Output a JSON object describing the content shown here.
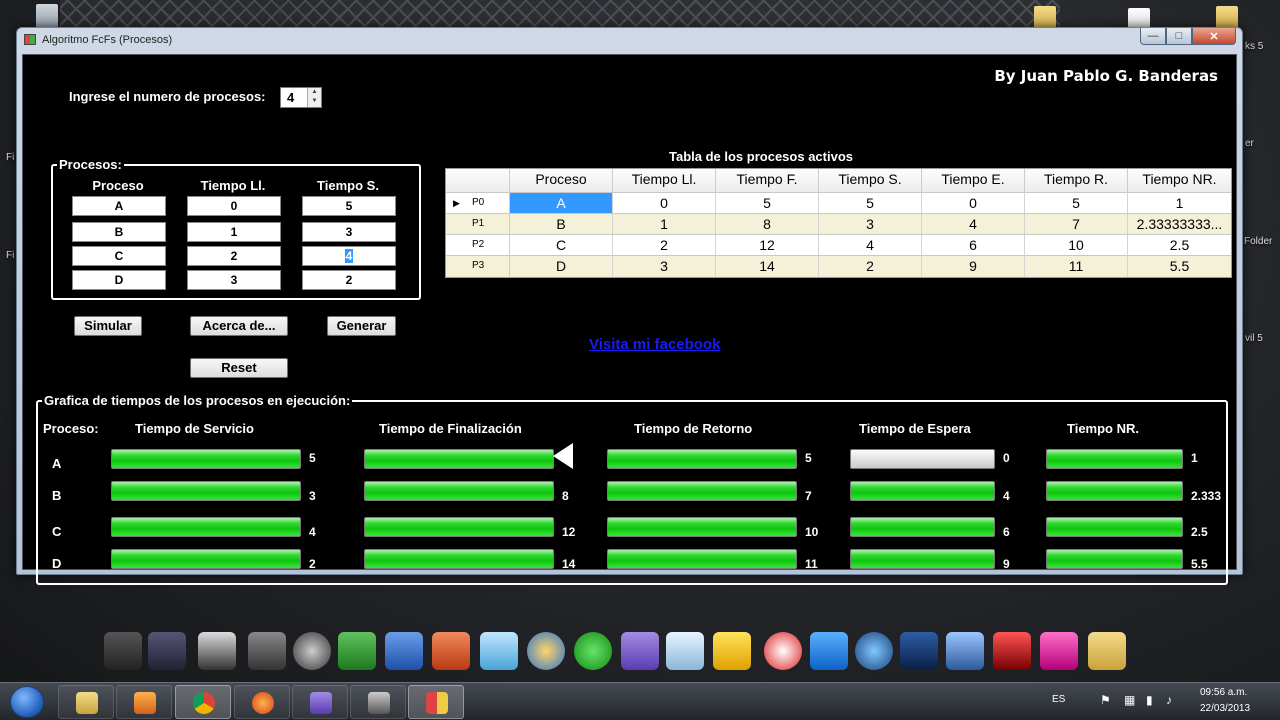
{
  "window": {
    "title": "Algoritmo FcFs (Procesos)",
    "author": "By Juan Pablo G. Banderas"
  },
  "input": {
    "label": "Ingrese el numero de procesos:",
    "count": "4"
  },
  "procesos_group": {
    "title": "Procesos:",
    "headers": [
      "Proceso",
      "Tiempo Ll.",
      "Tiempo S."
    ],
    "rows": [
      {
        "proceso": "A",
        "llegada": "0",
        "servicio": "5"
      },
      {
        "proceso": "B",
        "llegada": "1",
        "servicio": "3"
      },
      {
        "proceso": "C",
        "llegada": "2",
        "servicio": "4"
      },
      {
        "proceso": "D",
        "llegada": "3",
        "servicio": "2"
      }
    ]
  },
  "buttons": {
    "simular": "Simular",
    "acerca": "Acerca de...",
    "generar": "Generar",
    "reset": "Reset"
  },
  "link": "Visita mi facebook",
  "table": {
    "title": "Tabla de los procesos activos",
    "headers": [
      "Proceso",
      "Tiempo Ll.",
      "Tiempo F.",
      "Tiempo S.",
      "Tiempo E.",
      "Tiempo R.",
      "Tiempo NR."
    ],
    "rows": [
      {
        "id": "P0",
        "cells": [
          "A",
          "0",
          "5",
          "5",
          "0",
          "5",
          "1"
        ]
      },
      {
        "id": "P1",
        "cells": [
          "B",
          "1",
          "8",
          "3",
          "4",
          "7",
          "2.33333333..."
        ]
      },
      {
        "id": "P2",
        "cells": [
          "C",
          "2",
          "12",
          "4",
          "6",
          "10",
          "2.5"
        ]
      },
      {
        "id": "P3",
        "cells": [
          "D",
          "3",
          "14",
          "2",
          "9",
          "11",
          "5.5"
        ]
      }
    ]
  },
  "chart_group": {
    "title": "Grafica de tiempos de los procesos en ejecución:",
    "row_header": "Proceso:",
    "columns": [
      "Tiempo de Servicio",
      "Tiempo de Finalización",
      "Tiempo de Retorno",
      "Tiempo de Espera",
      "Tiempo NR."
    ],
    "processes": [
      "A",
      "B",
      "C",
      "D"
    ],
    "values": [
      [
        "5",
        "3",
        "4",
        "2"
      ],
      [
        "",
        "8",
        "12",
        "14"
      ],
      [
        "5",
        "7",
        "10",
        "11"
      ],
      [
        "0",
        "4",
        "6",
        "9"
      ],
      [
        "1",
        "2.333",
        "2.5",
        "5.5"
      ]
    ],
    "fills": [
      [
        1,
        1,
        1,
        1
      ],
      [
        1,
        1,
        1,
        1
      ],
      [
        1,
        1,
        1,
        1
      ],
      [
        0,
        1,
        1,
        1
      ],
      [
        1,
        1,
        1,
        1
      ]
    ]
  },
  "taskbar": {
    "lang": "ES",
    "time": "09:56 a.m.",
    "date": "22/03/2013"
  },
  "desktop_labels": [
    "ks 5",
    "er",
    "Folder",
    "vil 5",
    "Fi",
    "Fi"
  ]
}
